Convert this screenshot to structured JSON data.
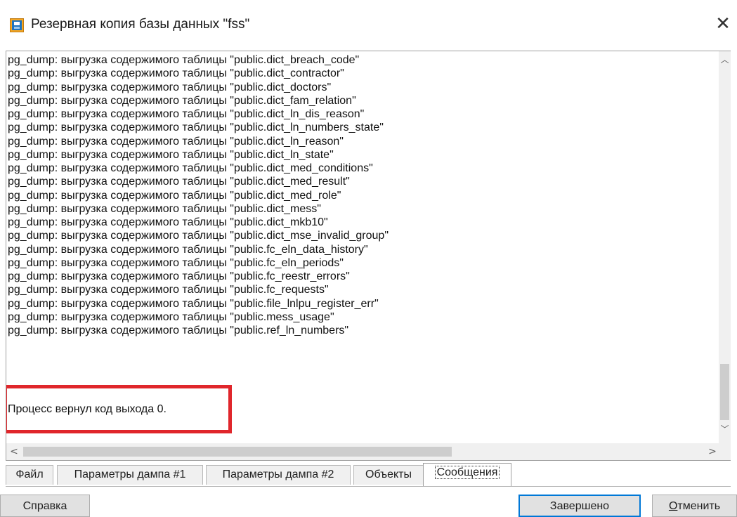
{
  "window": {
    "title": "Резервная копия базы данных \"fss\"",
    "close_symbol": "✕",
    "icon": "database-backup-icon"
  },
  "log": {
    "lines": [
      "pg_dump: выгрузка содержимого таблицы \"public.dict_breach_code\"",
      "pg_dump: выгрузка содержимого таблицы \"public.dict_contractor\"",
      "pg_dump: выгрузка содержимого таблицы \"public.dict_doctors\"",
      "pg_dump: выгрузка содержимого таблицы \"public.dict_fam_relation\"",
      "pg_dump: выгрузка содержимого таблицы \"public.dict_ln_dis_reason\"",
      "pg_dump: выгрузка содержимого таблицы \"public.dict_ln_numbers_state\"",
      "pg_dump: выгрузка содержимого таблицы \"public.dict_ln_reason\"",
      "pg_dump: выгрузка содержимого таблицы \"public.dict_ln_state\"",
      "pg_dump: выгрузка содержимого таблицы \"public.dict_med_conditions\"",
      "pg_dump: выгрузка содержимого таблицы \"public.dict_med_result\"",
      "pg_dump: выгрузка содержимого таблицы \"public.dict_med_role\"",
      "pg_dump: выгрузка содержимого таблицы \"public.dict_mess\"",
      "pg_dump: выгрузка содержимого таблицы \"public.dict_mkb10\"",
      "pg_dump: выгрузка содержимого таблицы \"public.dict_mse_invalid_group\"",
      "pg_dump: выгрузка содержимого таблицы \"public.fc_eln_data_history\"",
      "pg_dump: выгрузка содержимого таблицы \"public.fc_eln_periods\"",
      "pg_dump: выгрузка содержимого таблицы \"public.fc_reestr_errors\"",
      "pg_dump: выгрузка содержимого таблицы \"public.fc_requests\"",
      "pg_dump: выгрузка содержимого таблицы \"public.file_lnlpu_register_err\"",
      "pg_dump: выгрузка содержимого таблицы \"public.mess_usage\"",
      "pg_dump: выгрузка содержимого таблицы \"public.ref_ln_numbers\""
    ],
    "exit_message": "Процесс вернул код выхода 0.",
    "highlight_color": "#e0262b"
  },
  "scrollbars": {
    "up": "︿",
    "down": "﹀",
    "left": "<",
    "right": ">"
  },
  "tabs": [
    {
      "label": "Файл"
    },
    {
      "label": "Параметры дампа #1"
    },
    {
      "label": "Параметры дампа #2"
    },
    {
      "label": "Объекты"
    },
    {
      "label": "Сообщения",
      "active": true
    }
  ],
  "buttons": {
    "help": "Справка",
    "done": "Завершено",
    "cancel_underlined": "О",
    "cancel_rest": "тменить"
  },
  "colors": {
    "accent": "#0078d7"
  }
}
